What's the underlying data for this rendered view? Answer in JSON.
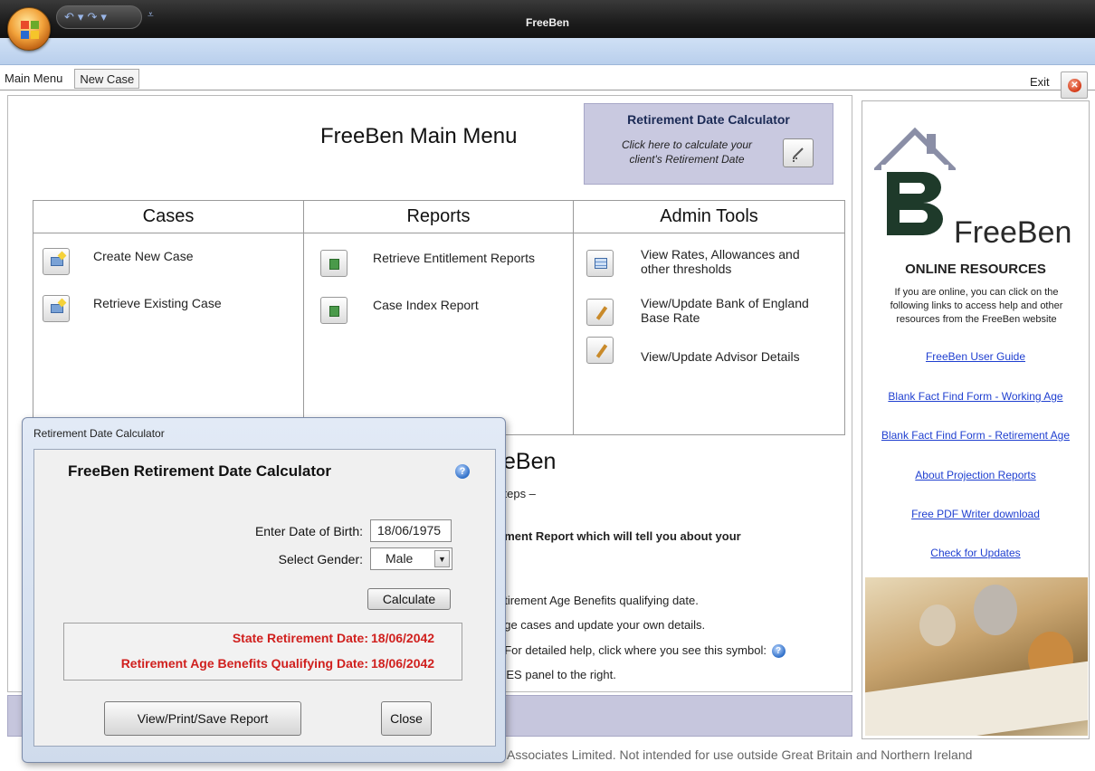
{
  "window": {
    "title": "FreeBen"
  },
  "tabs": [
    {
      "label": "Main Menu"
    },
    {
      "label": "New Case"
    }
  ],
  "exit_label": "Exit",
  "main": {
    "title": "FreeBen Main Menu",
    "retirement_calc_box": {
      "heading": "Retirement Date Calculator",
      "line1": "Click here to calculate your",
      "line2": "client's Retirement Date"
    },
    "columns": [
      {
        "header": "Cases",
        "items": [
          {
            "label": "Create New Case"
          },
          {
            "label": "Retrieve Existing Case"
          }
        ]
      },
      {
        "header": "Reports",
        "items": [
          {
            "label": "Retrieve Entitlement Reports"
          },
          {
            "label": "Case Index Report"
          }
        ]
      },
      {
        "header": "Admin Tools",
        "items": [
          {
            "line1": "View Rates, Allowances and",
            "line2": "other thresholds"
          },
          {
            "line1": "View/Update Bank of England",
            "line2": "Base Rate"
          },
          {
            "line1": "View/Update Advisor Details",
            "line2": ""
          }
        ]
      }
    ],
    "behind": {
      "title": "eBen",
      "lines": [
        "steps –",
        "ement Report which will tell you about your",
        "etirement Age Benefits qualifying date.",
        "age cases and update your own details.",
        ": For detailed help, click where you see this symbol:",
        "CES panel to the right."
      ]
    },
    "footer": "Associates Limited. Not intended for use outside Great Britain and Northern Ireland"
  },
  "right_panel": {
    "brand": "FreeBen",
    "heading": "ONLINE RESOURCES",
    "description": [
      "If you are online, you can click on the",
      "following links to access help and other",
      "resources from the FreeBen website"
    ],
    "links": [
      "FreeBen User Guide",
      "Blank Fact Find Form - Working Age",
      "Blank Fact Find Form - Retirement Age",
      "About Projection Reports",
      "Free PDF Writer download",
      "Check for Updates"
    ]
  },
  "dialog": {
    "title": "Retirement Date Calculator",
    "heading": "FreeBen Retirement Date Calculator",
    "dob_label": "Enter Date of Birth:",
    "dob_value": "18/06/1975",
    "gender_label": "Select Gender:",
    "gender_value": "Male",
    "calculate_label": "Calculate",
    "state_label": "State Retirement Date:",
    "state_value": "18/06/2042",
    "rabq_label": "Retirement Age Benefits Qualifying Date:",
    "rabq_value": "18/06/2042",
    "report_label": "View/Print/Save Report",
    "close_label": "Close"
  },
  "colors": {
    "accent_red": "#d0201e",
    "link_blue": "#1f3fd0",
    "panel_lavender": "#c9c9e0"
  },
  "icons": [
    "office-orb-icon",
    "undo-icon",
    "redo-icon",
    "qat-dropdown-icon",
    "exit-close-icon",
    "help-icon",
    "calendar-edit-icon"
  ]
}
